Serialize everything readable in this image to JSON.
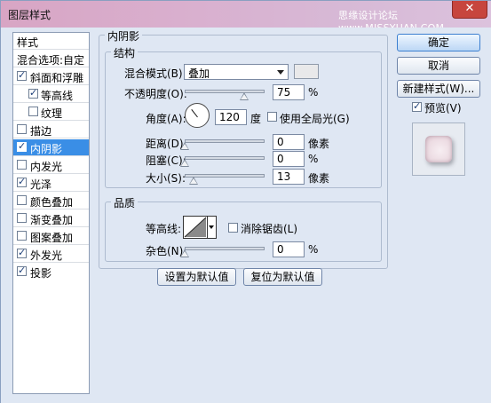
{
  "window": {
    "title": "图层样式",
    "watermark": "思缘设计论坛 www.MISSYUAN.COM",
    "close_icon": "close-x-icon"
  },
  "style_list": {
    "header": "样式",
    "blend_options": "混合选项:自定",
    "items": [
      {
        "label": "斜面和浮雕",
        "checked": true
      },
      {
        "label": "等高线",
        "checked": true
      },
      {
        "label": "纹理",
        "checked": false
      },
      {
        "label": "描边",
        "checked": false
      },
      {
        "label": "内阴影",
        "checked": true,
        "selected": true
      },
      {
        "label": "内发光",
        "checked": false
      },
      {
        "label": "光泽",
        "checked": true
      },
      {
        "label": "颜色叠加",
        "checked": false
      },
      {
        "label": "渐变叠加",
        "checked": false
      },
      {
        "label": "图案叠加",
        "checked": false
      },
      {
        "label": "外发光",
        "checked": true
      },
      {
        "label": "投影",
        "checked": true
      }
    ]
  },
  "inner_shadow": {
    "title": "内阴影",
    "structure": {
      "title": "结构",
      "blend_mode_label": "混合模式(B):",
      "blend_mode_value": "叠加",
      "swatch_color": "#e9e9ea",
      "opacity_label": "不透明度(O):",
      "opacity_value": "75",
      "opacity_unit": "%",
      "angle_label": "角度(A):",
      "angle_value": "120",
      "angle_unit": "度",
      "global_light_label": "使用全局光(G)",
      "global_light_checked": false,
      "distance_label": "距离(D):",
      "distance_value": "0",
      "distance_unit": "像素",
      "choke_label": "阻塞(C):",
      "choke_value": "0",
      "choke_unit": "%",
      "size_label": "大小(S):",
      "size_value": "13",
      "size_unit": "像素"
    },
    "quality": {
      "title": "品质",
      "contour_label": "等高线:",
      "anti_alias_label": "消除锯齿(L)",
      "anti_alias_checked": false,
      "noise_label": "杂色(N):",
      "noise_value": "0",
      "noise_unit": "%"
    },
    "make_default": "设置为默认值",
    "reset_default": "复位为默认值"
  },
  "buttons": {
    "ok": "确定",
    "cancel": "取消",
    "new_style": "新建样式(W)...",
    "preview_label": "预览(V)",
    "preview_checked": true
  }
}
